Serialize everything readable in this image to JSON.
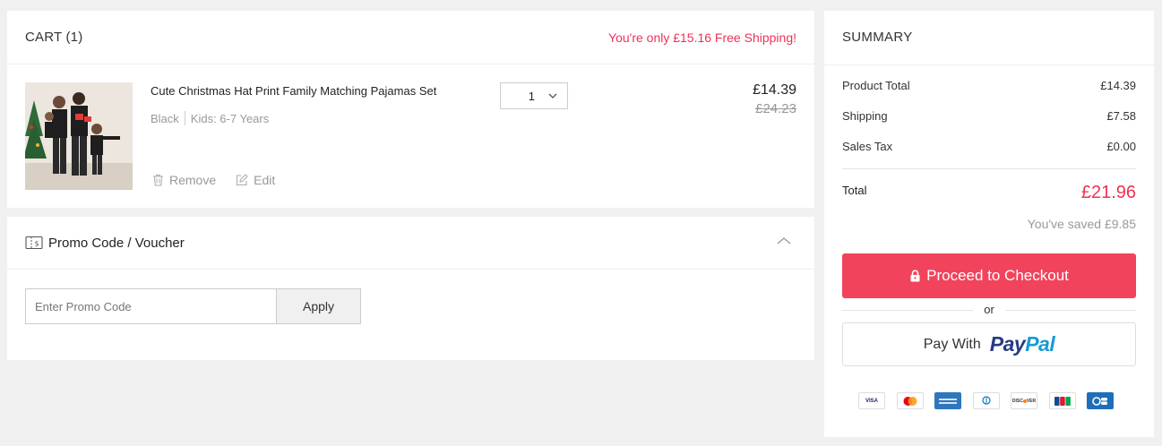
{
  "cart": {
    "title": "CART (1)",
    "free_shipping_msg": "You're only £15.16 Free Shipping!",
    "items": [
      {
        "name": "Cute Christmas Hat Print Family Matching Pajamas Set",
        "color": "Black",
        "size": "Kids: 6-7 Years",
        "quantity": "1",
        "price": "£14.39",
        "original_price": "£24.23",
        "remove_label": "Remove",
        "edit_label": "Edit"
      }
    ]
  },
  "promo": {
    "title": "Promo Code / Voucher",
    "input_placeholder": "Enter Promo Code",
    "apply_label": "Apply"
  },
  "summary": {
    "title": "SUMMARY",
    "rows": [
      {
        "label": "Product Total",
        "value": "£14.39"
      },
      {
        "label": "Shipping",
        "value": "£7.58"
      },
      {
        "label": "Sales Tax",
        "value": "£0.00"
      }
    ],
    "total_label": "Total",
    "total_value": "£21.96",
    "saved_text": "You've saved £9.85",
    "checkout_label": "Proceed to Checkout",
    "or_text": "or",
    "pay_with_label": "Pay With",
    "paypal_part1": "Pay",
    "paypal_part2": "Pal",
    "payment_icons": [
      "visa-icon",
      "mastercard-icon",
      "amex-icon",
      "diners-club-icon",
      "discover-icon",
      "jcb-icon",
      "cb-icon"
    ]
  },
  "colors": {
    "accent": "#ee3158",
    "checkout_button": "#f2435c",
    "paypal_dark": "#253b80",
    "paypal_light": "#179bd7"
  }
}
